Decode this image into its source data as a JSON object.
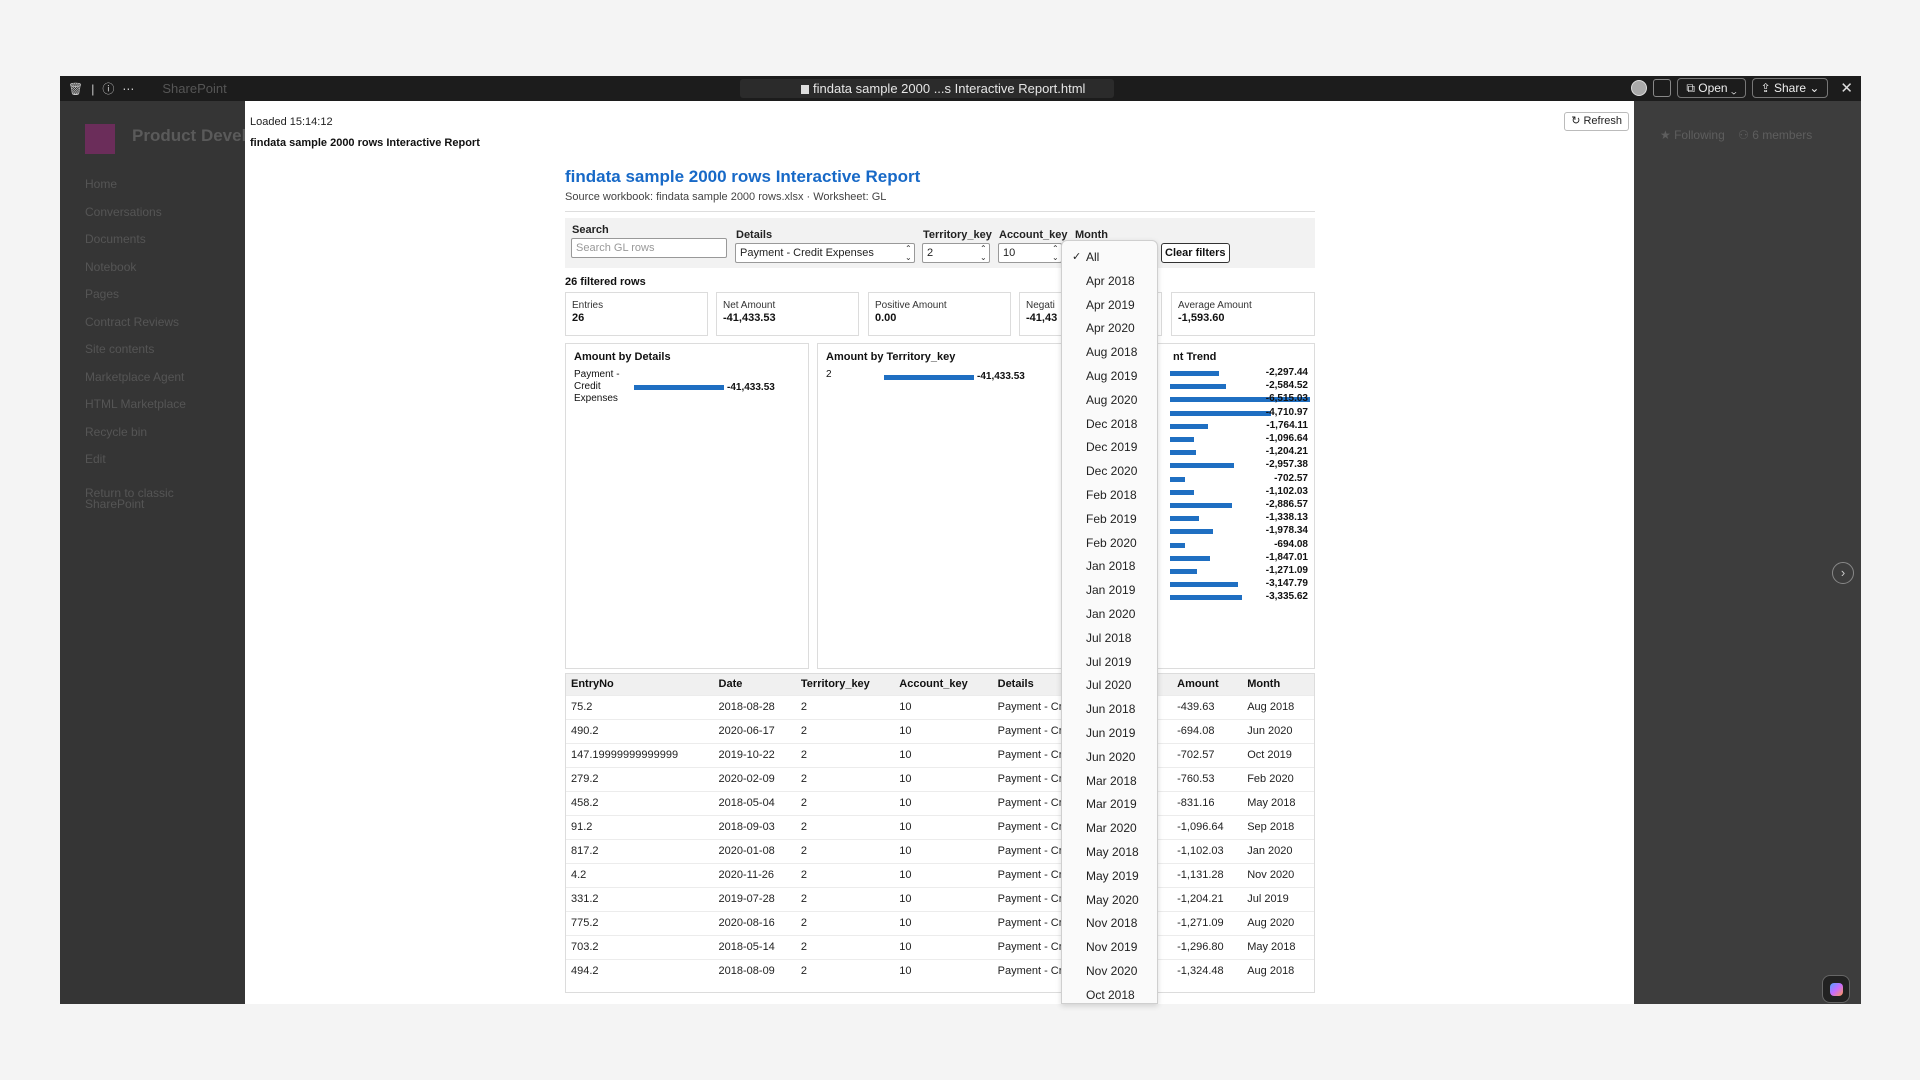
{
  "viewer": {
    "title": "findata sample 2000 ...s Interactive Report.html",
    "ghost_app": "SharePoint",
    "open_label": "Open",
    "share_label": "Share"
  },
  "background": {
    "site_name": "Product Development",
    "nav": [
      "Home",
      "Conversations",
      "Documents",
      "Notebook",
      "Pages",
      "Contract Reviews",
      "Site contents",
      "Marketplace Agent",
      "HTML Marketplace",
      "Recycle bin",
      "Edit"
    ],
    "return_link": "Return to classic SharePoint",
    "following": "Following",
    "members": "6 members"
  },
  "panel": {
    "loaded": "Loaded 15:14:12",
    "title": "findata sample 2000 rows Interactive Report",
    "refresh": "↻ Refresh"
  },
  "report": {
    "title": "findata sample 2000 rows Interactive Report",
    "subtitle": "Source workbook: findata sample 2000 rows.xlsx · Worksheet: GL",
    "filters": {
      "search_label": "Search",
      "search_placeholder": "Search GL rows",
      "details_label": "Details",
      "details_value": "Payment - Credit Expenses",
      "territory_label": "Territory_key",
      "territory_value": "2",
      "account_label": "Account_key",
      "account_value": "10",
      "month_label": "Month",
      "clear_label": "Clear filters"
    },
    "row_count": "26 filtered rows",
    "kpis": [
      {
        "label": "Entries",
        "value": "26"
      },
      {
        "label": "Net Amount",
        "value": "-41,433.53"
      },
      {
        "label": "Positive Amount",
        "value": "0.00"
      },
      {
        "label": "Negati",
        "value": "-41,43"
      },
      {
        "label": "Average Amount",
        "value": "-1,593.60"
      }
    ],
    "charts": {
      "details_title": "Amount by Details",
      "territory_title": "Amount by Territory_key",
      "trend_title": "nt Trend"
    }
  },
  "chart_data": [
    {
      "type": "bar",
      "title": "Amount by Details",
      "categories": [
        "Payment - Credit Expenses"
      ],
      "values": [
        -41433.53
      ],
      "labels": [
        "-41,433.53"
      ]
    },
    {
      "type": "bar",
      "title": "Amount by Territory_key",
      "categories": [
        "2"
      ],
      "values": [
        -41433.53
      ],
      "labels": [
        "-41,433.53"
      ]
    },
    {
      "type": "bar",
      "title": "nt Trend",
      "values": [
        -2297.44,
        -2584.52,
        -6515.03,
        -4710.97,
        -1764.11,
        -1096.64,
        -1204.21,
        -2957.38,
        -702.57,
        -1102.03,
        -2886.57,
        -1338.13,
        -1978.34,
        -694.08,
        -1847.01,
        -1271.09,
        -3147.79,
        -3335.62
      ],
      "labels": [
        "-2,297.44",
        "-2,584.52",
        "-6,515.03",
        "-4,710.97",
        "-1,764.11",
        "-1,096.64",
        "-1,204.21",
        "-2,957.38",
        "-702.57",
        "-1,102.03",
        "-2,886.57",
        "-1,338.13",
        "-1,978.34",
        "-694.08",
        "-1,847.01",
        "-1,271.09",
        "-3,147.79",
        "-3,335.62"
      ]
    }
  ],
  "table": {
    "columns": [
      "EntryNo",
      "Date",
      "Territory_key",
      "Account_key",
      "Details",
      "Amount",
      "Month"
    ],
    "rows": [
      [
        "75.2",
        "2018-08-28",
        "2",
        "10",
        "Payment - Cr",
        "-439.63",
        "Aug 2018"
      ],
      [
        "490.2",
        "2020-06-17",
        "2",
        "10",
        "Payment - Cr",
        "-694.08",
        "Jun 2020"
      ],
      [
        "147.19999999999999",
        "2019-10-22",
        "2",
        "10",
        "Payment - Cr",
        "-702.57",
        "Oct 2019"
      ],
      [
        "279.2",
        "2020-02-09",
        "2",
        "10",
        "Payment - Cr",
        "-760.53",
        "Feb 2020"
      ],
      [
        "458.2",
        "2018-05-04",
        "2",
        "10",
        "Payment - Cr",
        "-831.16",
        "May 2018"
      ],
      [
        "91.2",
        "2018-09-03",
        "2",
        "10",
        "Payment - Cr",
        "-1,096.64",
        "Sep 2018"
      ],
      [
        "817.2",
        "2020-01-08",
        "2",
        "10",
        "Payment - Cr",
        "-1,102.03",
        "Jan 2020"
      ],
      [
        "4.2",
        "2020-11-26",
        "2",
        "10",
        "Payment - Cr",
        "-1,131.28",
        "Nov 2020"
      ],
      [
        "331.2",
        "2019-07-28",
        "2",
        "10",
        "Payment - Cr",
        "-1,204.21",
        "Jul 2019"
      ],
      [
        "775.2",
        "2020-08-16",
        "2",
        "10",
        "Payment - Cr",
        "-1,271.09",
        "Aug 2020"
      ],
      [
        "703.2",
        "2018-05-14",
        "2",
        "10",
        "Payment - Cr",
        "-1,296.80",
        "May 2018"
      ],
      [
        "494.2",
        "2018-08-09",
        "2",
        "10",
        "Payment - Cr",
        "-1,324.48",
        "Aug 2018"
      ]
    ]
  },
  "month_dropdown": {
    "selected": "All",
    "options": [
      "All",
      "Apr 2018",
      "Apr 2019",
      "Apr 2020",
      "Aug 2018",
      "Aug 2019",
      "Aug 2020",
      "Dec 2018",
      "Dec 2019",
      "Dec 2020",
      "Feb 2018",
      "Feb 2019",
      "Feb 2020",
      "Jan 2018",
      "Jan 2019",
      "Jan 2020",
      "Jul 2018",
      "Jul 2019",
      "Jul 2020",
      "Jun 2018",
      "Jun 2019",
      "Jun 2020",
      "Mar 2018",
      "Mar 2019",
      "Mar 2020",
      "May 2018",
      "May 2019",
      "May 2020",
      "Nov 2018",
      "Nov 2019",
      "Nov 2020",
      "Oct 2018"
    ]
  },
  "colors": {
    "accent": "#1769c7",
    "bar": "#1f6fc2"
  }
}
